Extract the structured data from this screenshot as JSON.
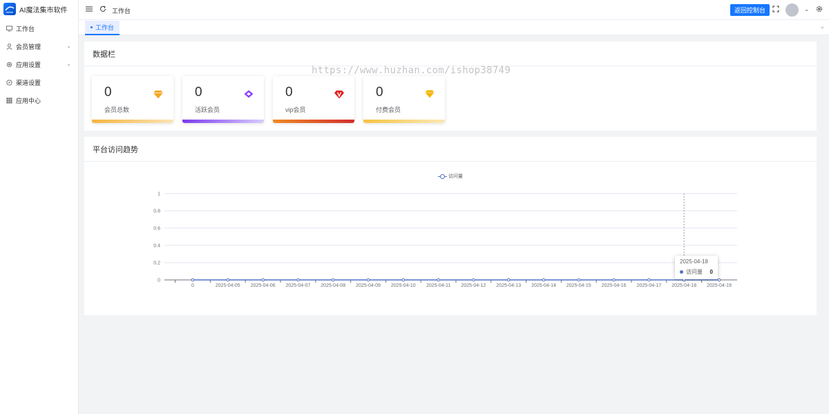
{
  "app": {
    "title": "AI魔法集市软件"
  },
  "sidebar": {
    "items": [
      {
        "label": "工作台",
        "icon": "monitor-icon"
      },
      {
        "label": "会员管理",
        "icon": "user-icon",
        "expandable": true
      },
      {
        "label": "应用设置",
        "icon": "gear-icon",
        "expandable": true
      },
      {
        "label": "渠道设置",
        "icon": "compass-icon"
      },
      {
        "label": "应用中心",
        "icon": "grid-icon"
      }
    ]
  },
  "header": {
    "breadcrumb": "工作台",
    "back_button": "返回控制台"
  },
  "tabs": [
    {
      "label": "工作台",
      "active": true
    }
  ],
  "data_panel": {
    "title": "数据栏",
    "cards": [
      {
        "value": "0",
        "label": "会员总数",
        "icon": "diamond-icon",
        "color": "#f5a623",
        "bar": "#f5b642"
      },
      {
        "value": "0",
        "label": "活跃会员",
        "icon": "gem-icon",
        "color": "#8b3dff",
        "bar": "#8b5cf6"
      },
      {
        "value": "0",
        "label": "vip会员",
        "icon": "vip-icon",
        "color": "#e02020",
        "bar": "#e0521e"
      },
      {
        "value": "0",
        "label": "付费会员",
        "icon": "crown-icon",
        "color": "#f5b400",
        "bar": "#f5c542"
      }
    ]
  },
  "watermark": "https://www.huzhan.com/ishop38749",
  "trend_panel": {
    "title": "平台访问趋势"
  },
  "chart_data": {
    "type": "line",
    "categories": [
      "0",
      "2025-04-05",
      "2025-04-06",
      "2025-04-07",
      "2025-04-08",
      "2025-04-09",
      "2025-04-10",
      "2025-04-11",
      "2025-04-12",
      "2025-04-13",
      "2025-04-14",
      "2025-04-15",
      "2025-04-16",
      "2025-04-17",
      "2025-04-18",
      "2025-04-19"
    ],
    "series": [
      {
        "name": "访问量",
        "values": [
          0,
          0,
          0,
          0,
          0,
          0,
          0,
          0,
          0,
          0,
          0,
          0,
          0,
          0,
          0,
          0
        ],
        "color": "#5470c6"
      }
    ],
    "ylim": [
      0,
      1
    ],
    "yticks": [
      "0",
      "0.2",
      "0.4",
      "0.6",
      "0.8",
      "1"
    ],
    "grid": true,
    "legend": "top-center",
    "tooltip": {
      "title": "2025-04-18",
      "series": "访问量",
      "value": "0"
    }
  }
}
